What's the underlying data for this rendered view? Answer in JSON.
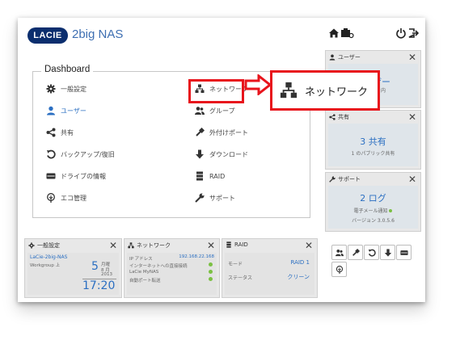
{
  "header": {
    "logo": "LACIE",
    "title": "2big NAS"
  },
  "dashboard": {
    "legend": "Dashboard",
    "items": [
      {
        "label": "一般設定",
        "icon": "gear-icon"
      },
      {
        "label": "ネットワーク",
        "icon": "network-icon"
      },
      {
        "label": "ユーザー",
        "icon": "user-icon"
      },
      {
        "label": "グループ",
        "icon": "group-icon"
      },
      {
        "label": "共有",
        "icon": "share-icon"
      },
      {
        "label": "外付けポート",
        "icon": "usb-icon"
      },
      {
        "label": "バックアップ/復旧",
        "icon": "backup-icon"
      },
      {
        "label": "ダウンロード",
        "icon": "download-icon"
      },
      {
        "label": "ドライブの情報",
        "icon": "drive-icon"
      },
      {
        "label": "RAID",
        "icon": "raid-icon"
      },
      {
        "label": "エコ管理",
        "icon": "eco-icon"
      },
      {
        "label": "サポート",
        "icon": "support-icon"
      }
    ]
  },
  "callout": {
    "label": "ネットワーク"
  },
  "right_panels": {
    "users": {
      "title": "ユーザー",
      "big": "ザー",
      "small": "内"
    },
    "shares": {
      "title": "共有",
      "big": "3 共有",
      "small": "1 のパブリック共有"
    },
    "support": {
      "title": "サポート",
      "big": "2 ログ",
      "small1": "電子メール通知",
      "small2": "バージョン 3.0.5.6"
    }
  },
  "bottom_panels": {
    "general": {
      "title": "一般設定",
      "device": "LaCie-2big-NAS",
      "workgroup": "Workgroup 上",
      "day": "5",
      "weekday": "月曜",
      "month": "8 月",
      "year": "2013",
      "time": "17:20"
    },
    "network": {
      "title": "ネットワーク",
      "ip_label": "IP アドレス",
      "ip": "192.168.22.168",
      "internet": "インターネットへの直接接続",
      "mynas": "LaCie MyNAS",
      "port": "自動ポート転送"
    },
    "raid": {
      "title": "RAID",
      "mode_label": "モード",
      "mode": "RAID 1",
      "status_label": "ステータス",
      "status": "クリーン"
    }
  }
}
